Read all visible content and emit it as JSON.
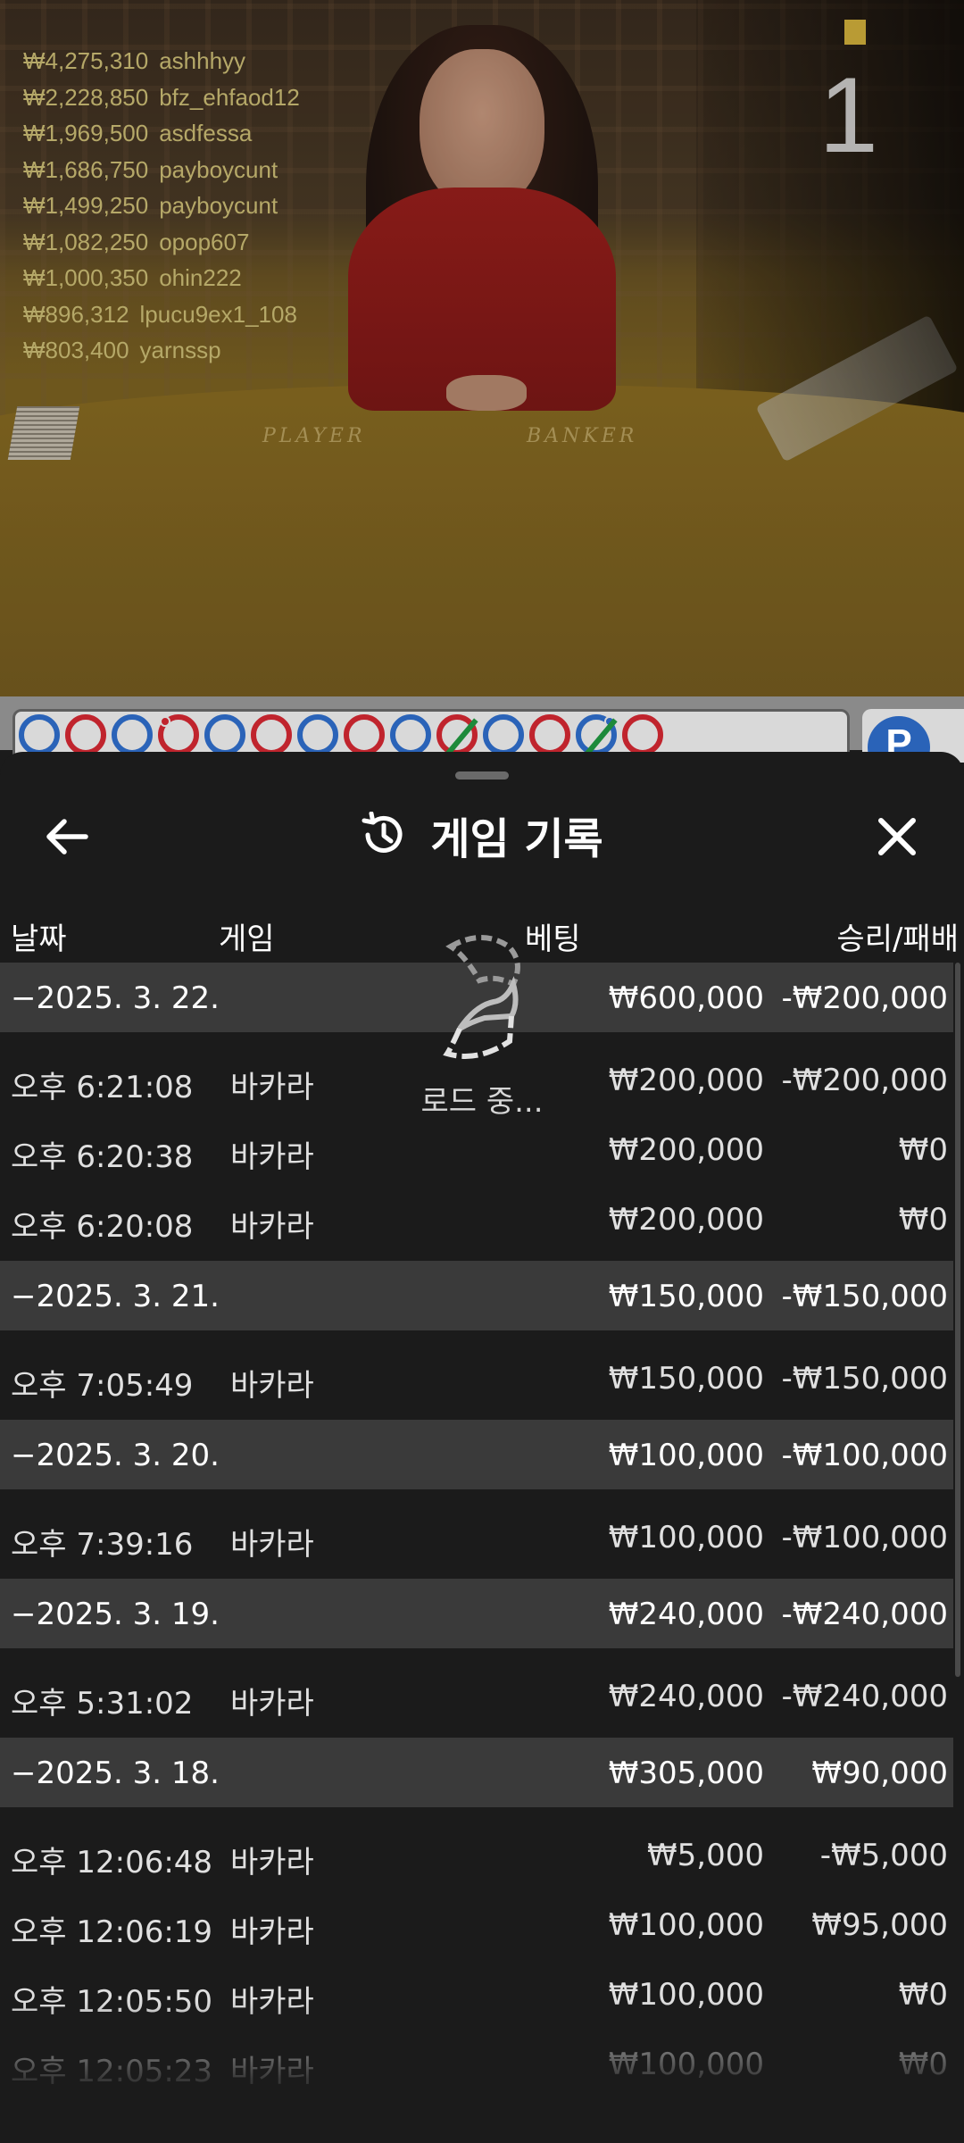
{
  "video": {
    "round_number": "1",
    "table_labels": [
      "PLAYER",
      "BANKER"
    ],
    "winners": [
      {
        "amount": "₩4,275,310",
        "user": "ashhhyy"
      },
      {
        "amount": "₩2,228,850",
        "user": "bfz_ehfaod12"
      },
      {
        "amount": "₩1,969,500",
        "user": "asdfessa"
      },
      {
        "amount": "₩1,686,750",
        "user": "payboycunt"
      },
      {
        "amount": "₩1,499,250",
        "user": "payboycunt"
      },
      {
        "amount": "₩1,082,250",
        "user": "opop607"
      },
      {
        "amount": "₩1,000,350",
        "user": "ohin222"
      },
      {
        "amount": "₩896,312",
        "user": "lpucu9ex1_108"
      },
      {
        "amount": "₩803,400",
        "user": "yarnssp"
      }
    ]
  },
  "road": {
    "beads": [
      "blue",
      "red",
      "blue",
      "red-dot",
      "blue",
      "red",
      "blue",
      "red",
      "blue",
      "red-slash",
      "blue",
      "red",
      "blue-dot-slash",
      "red"
    ],
    "side_label": "P"
  },
  "sheet": {
    "title": "게임 기록",
    "icons": {
      "back": "arrow-left-icon",
      "history": "history-icon",
      "close": "close-icon",
      "loader": "loading-spinner-icon"
    },
    "columns": {
      "date": "날짜",
      "game": "게임",
      "bet": "베팅",
      "result": "승리/패배"
    },
    "groups": [
      {
        "date": "−2025. 3. 22.",
        "bet": "₩600,000",
        "result": "-₩200,000",
        "items": [
          {
            "time": "오후 6:21:08",
            "game": "바카라",
            "bet": "₩200,000",
            "result": "-₩200,000"
          },
          {
            "time": "오후 6:20:38",
            "game": "바카라",
            "bet": "₩200,000",
            "result": "₩0"
          },
          {
            "time": "오후 6:20:08",
            "game": "바카라",
            "bet": "₩200,000",
            "result": "₩0"
          }
        ]
      },
      {
        "date": "−2025. 3. 21.",
        "bet": "₩150,000",
        "result": "-₩150,000",
        "items": [
          {
            "time": "오후 7:05:49",
            "game": "바카라",
            "bet": "₩150,000",
            "result": "-₩150,000"
          }
        ]
      },
      {
        "date": "−2025. 3. 20.",
        "bet": "₩100,000",
        "result": "-₩100,000",
        "items": [
          {
            "time": "오후 7:39:16",
            "game": "바카라",
            "bet": "₩100,000",
            "result": "-₩100,000"
          }
        ]
      },
      {
        "date": "−2025. 3. 19.",
        "bet": "₩240,000",
        "result": "-₩240,000",
        "items": [
          {
            "time": "오후 5:31:02",
            "game": "바카라",
            "bet": "₩240,000",
            "result": "-₩240,000"
          }
        ]
      },
      {
        "date": "−2025. 3. 18.",
        "bet": "₩305,000",
        "result": "₩90,000",
        "items": [
          {
            "time": "오후 12:06:48",
            "game": "바카라",
            "bet": "₩5,000",
            "result": "-₩5,000"
          },
          {
            "time": "오후 12:06:19",
            "game": "바카라",
            "bet": "₩100,000",
            "result": "₩95,000"
          },
          {
            "time": "오후 12:05:50",
            "game": "바카라",
            "bet": "₩100,000",
            "result": "₩0"
          },
          {
            "time": "오후 12:05:23",
            "game": "바카라",
            "bet": "₩100,000",
            "result": "₩0"
          }
        ]
      }
    ],
    "loading_text": "로드 중..."
  }
}
